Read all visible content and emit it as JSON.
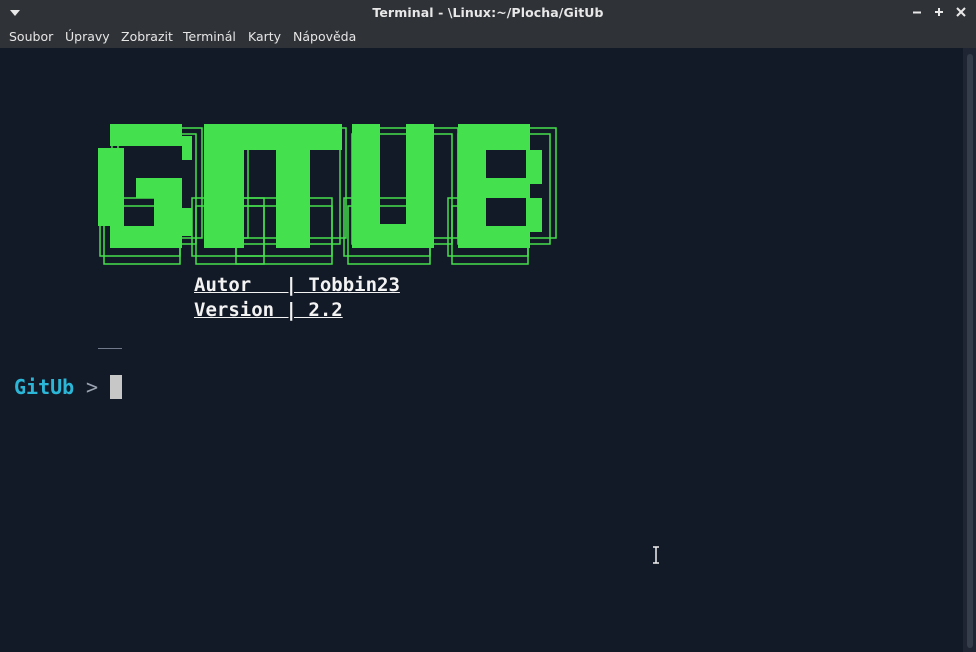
{
  "window": {
    "title": "Terminal - \\Linux:~/Plocha/GitUb",
    "buttons": [
      "minimize",
      "maximize",
      "close"
    ]
  },
  "menu": {
    "items": [
      "Soubor",
      "Úpravy",
      "Zobrazit",
      "Terminál",
      "Karty",
      "Nápověda"
    ]
  },
  "terminal": {
    "logo_text": "GITUB",
    "info_lines": [
      "Autor   | Tobbin23",
      "Version | 2.2"
    ],
    "prompt_label": "GitUb",
    "prompt_arrow": ">"
  },
  "colors": {
    "logo_green": "#45e04d",
    "prompt_blue": "#2bb6d7",
    "background": "#131a27"
  }
}
